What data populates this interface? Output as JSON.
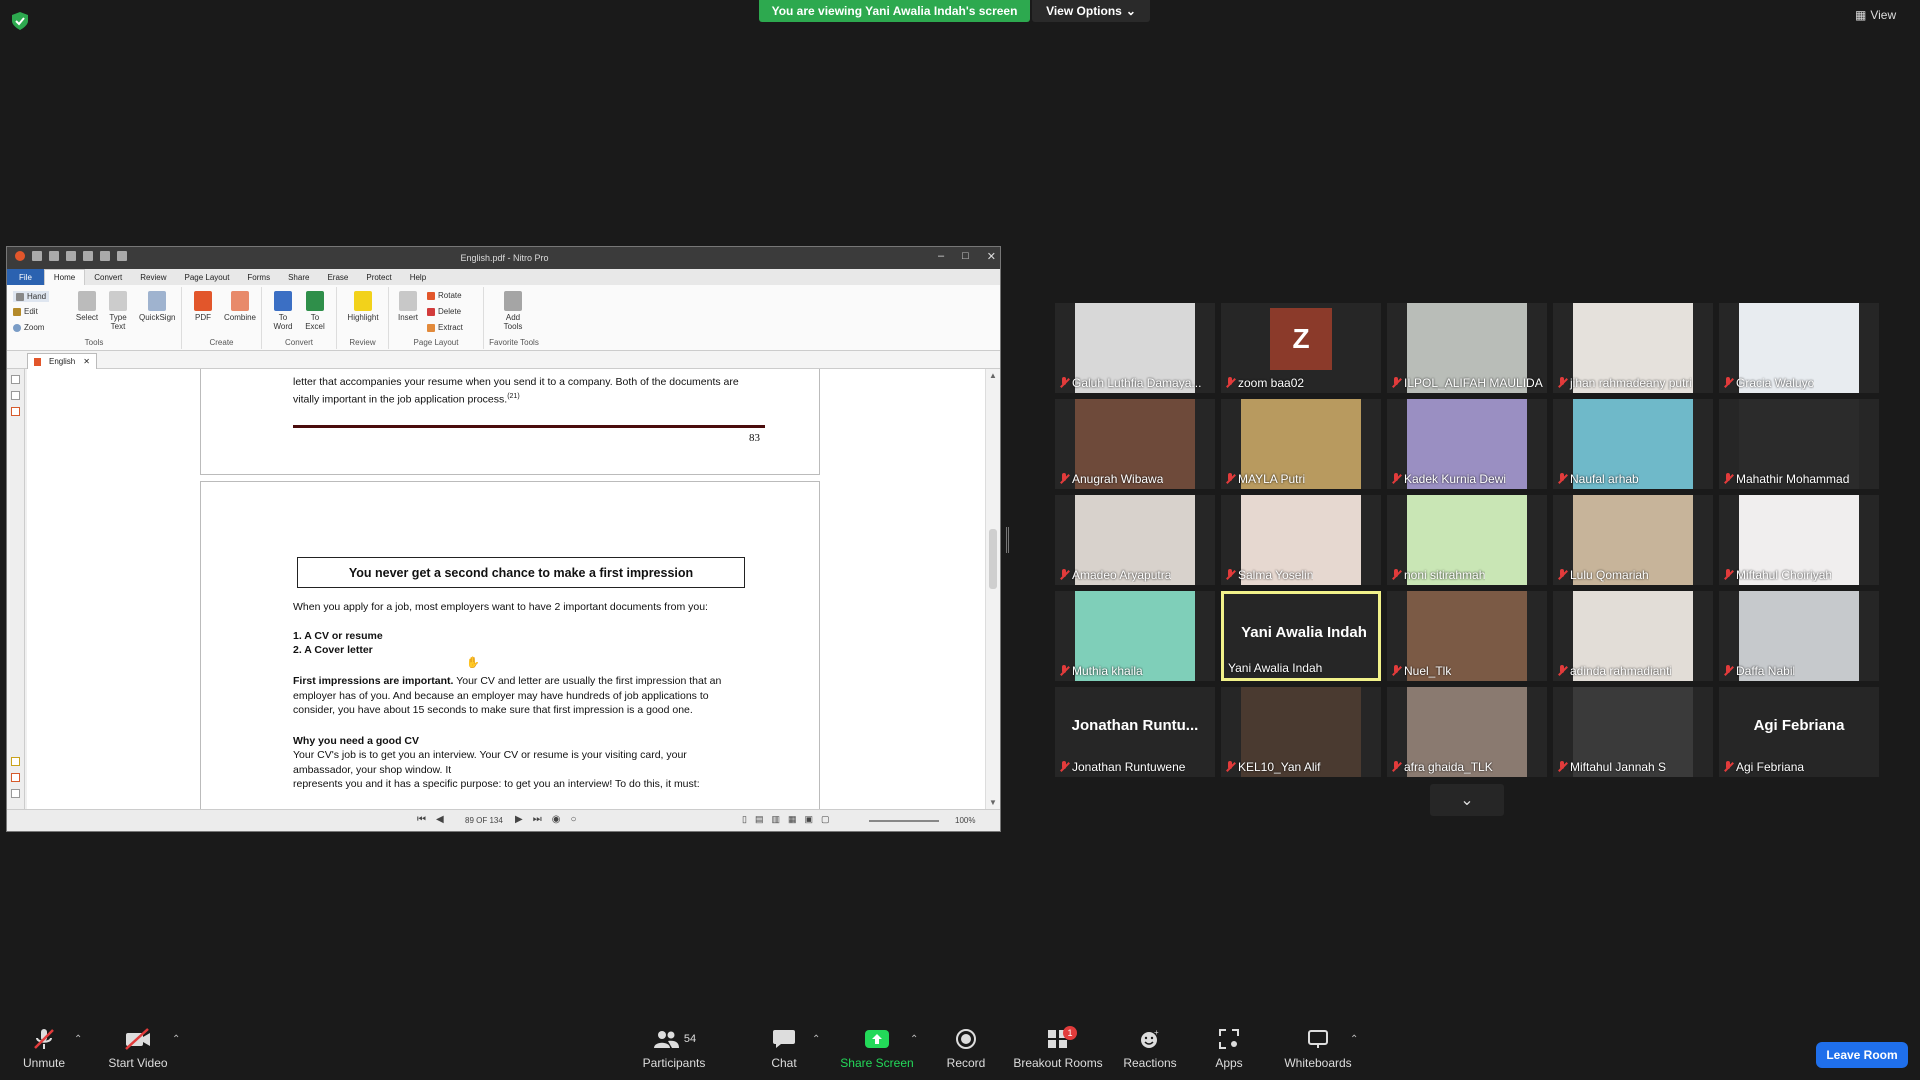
{
  "banner": {
    "viewing": "You are viewing Yani Awalia Indah's screen",
    "view_options": "View Options",
    "view": "View"
  },
  "app": {
    "title": "English.pdf - Nitro Pro",
    "menu": [
      "File",
      "Home",
      "Convert",
      "Review",
      "Page Layout",
      "Forms",
      "Share",
      "Erase",
      "Protect",
      "Help"
    ],
    "ribbon": {
      "tools_small": [
        "Hand",
        "Edit",
        "Zoom"
      ],
      "select": "Select",
      "type_text": "Type\nText",
      "quicksign": "QuickSign",
      "tools_label": "Tools",
      "pdf": "PDF",
      "combine": "Combine",
      "create_label": "Create",
      "to_word": "To\nWord",
      "to_excel": "To\nExcel",
      "convert_label": "Convert",
      "highlight": "Highlight",
      "review_label": "Review",
      "insert": "Insert",
      "rotate": "Rotate",
      "delete": "Delete",
      "extract": "Extract",
      "page_layout_label": "Page Layout",
      "add_tools": "Add\nTools",
      "favorite_label": "Favorite Tools"
    },
    "doc_tab": "English",
    "page1": {
      "text": "letter that accompanies your resume when you send it to a company. Both of the documents are vitally important in the job application process.",
      "ref": "(21)",
      "page_number": "83"
    },
    "page2": {
      "headline": "You never get a second chance to make a first impression",
      "p1": "When you apply for a job, most employers want to have 2 important documents from you:",
      "item1": "1. A CV or resume",
      "item2": "2. A Cover letter",
      "p2_bold": "First impressions are important.",
      "p2": " Your CV and letter are usually the first impression that an employer has of you. And because an employer may have hundreds of job applications to consider, you have about 15 seconds to make sure that first impression is a good one.",
      "h_why": "Why you need a good CV",
      "p3": "Your CV's job is to get you an interview. Your CV or resume is your visiting card, your ambassador, your shop window. It",
      "p4_cut": "represents you and it has a specific purpose: to get you an interview! To do this, it must:"
    },
    "status": {
      "page": "89 OF 134",
      "zoom": "100%"
    }
  },
  "participants": [
    {
      "name": "Galuh Luthfia Damaya...",
      "muted": true,
      "bg": "#d8d8d8"
    },
    {
      "name": "zoom baa02",
      "muted": true,
      "avatar": "Z"
    },
    {
      "name": "ILPOL_ALIFAH MAULIDA",
      "muted": true,
      "bg": "#b9bdb8"
    },
    {
      "name": "jihan rahmadeany putri",
      "muted": true,
      "bg": "#e5e1dc"
    },
    {
      "name": "Gracia Waluyo",
      "muted": true,
      "bg": "#e8ecf0"
    },
    {
      "name": "Anugrah Wibawa",
      "muted": true,
      "bg": "#6e4a3a"
    },
    {
      "name": "MAYLA Putri",
      "muted": true,
      "bg": "#b89a5f"
    },
    {
      "name": "Kadek Kurnia Dewi",
      "muted": true,
      "bg": "#9a8fc2"
    },
    {
      "name": "Naufal arhab",
      "muted": true,
      "bg": "#6fb9c9"
    },
    {
      "name": "Mahathir Mohammad",
      "muted": true,
      "bg": "#2b2b2b"
    },
    {
      "name": "Amadeo Aryaputra",
      "muted": true,
      "bg": "#d8d2cc"
    },
    {
      "name": "Salma Yoselin",
      "muted": true,
      "bg": "#e6d8d0"
    },
    {
      "name": "noni sitirahmah",
      "muted": true,
      "bg": "#c9e6b5"
    },
    {
      "name": "Lulu Qomariah",
      "muted": true,
      "bg": "#c7b49a"
    },
    {
      "name": "Miftahul Choiriyah",
      "muted": true,
      "bg": "#f0eeee"
    },
    {
      "name": "Muthia khaila",
      "muted": true,
      "bg": "#7fcfb9"
    },
    {
      "name": "Yani Awalia Indah",
      "muted": false,
      "active": true,
      "big": "Yani Awalia Indah"
    },
    {
      "name": "Nuel_Tlk",
      "muted": true,
      "bg": "#7b5a45"
    },
    {
      "name": "adinda rahmadianti",
      "muted": true,
      "bg": "#e2ddd7"
    },
    {
      "name": "Daffa Nabil",
      "muted": true,
      "bg": "#c6c9cc"
    },
    {
      "name": "Jonathan Runtuwene",
      "muted": true,
      "big": "Jonathan  Runtu..."
    },
    {
      "name": "KEL10_Yan Alif",
      "muted": true,
      "bg": "#4a3a30"
    },
    {
      "name": "afra ghaida_TLK",
      "muted": true,
      "bg": "#8a7a70"
    },
    {
      "name": "Miftahul Jannah S",
      "muted": true,
      "bg": "#3a3a3a"
    },
    {
      "name": "Agi Febriana",
      "muted": true,
      "big": "Agi Febriana"
    }
  ],
  "toolbar": {
    "unmute": "Unmute",
    "start_video": "Start Video",
    "participants": "Participants",
    "participants_count": "54",
    "chat": "Chat",
    "share_screen": "Share Screen",
    "record": "Record",
    "breakout": "Breakout Rooms",
    "breakout_badge": "1",
    "reactions": "Reactions",
    "apps": "Apps",
    "whiteboards": "Whiteboards",
    "leave": "Leave Room"
  },
  "colors": {
    "banner_green": "#2da94f",
    "share_green": "#23d959",
    "leave_blue": "#1f6feb",
    "muted_red": "#e23b3b",
    "active_border": "#f2f28a"
  }
}
